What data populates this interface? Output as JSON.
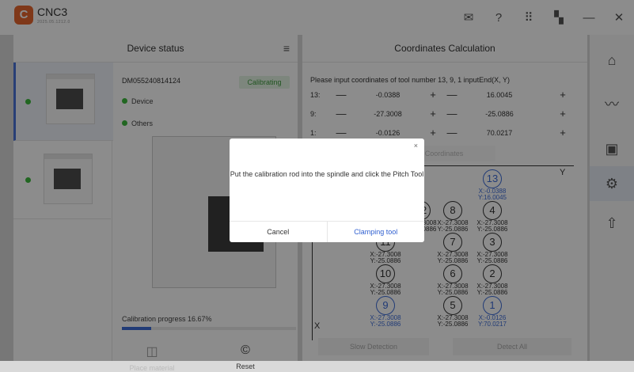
{
  "app": {
    "logo_glyph": "C",
    "title": "CNC3",
    "subtitle": "2025.05.1212.0"
  },
  "topbar_icons": [
    "mail-icon",
    "help-icon",
    "grid-icon",
    "device-icon",
    "minimize-icon",
    "close-icon"
  ],
  "topbar_glyphs": {
    "mail": "✉",
    "help": "?",
    "grid": "⠿",
    "device": "▚",
    "minimize": "—",
    "close": "✕"
  },
  "rail_glyphs": {
    "home": "⌂",
    "monitor": "〰",
    "screen": "▣",
    "settings": "⚙",
    "upload": "⇧"
  },
  "device_status": {
    "title": "Device status",
    "menu_glyph": "≡",
    "device_id": "DM055240814124",
    "badge": "Calibrating",
    "stat_device": "Device",
    "stat_others": "Others",
    "progress_label": "Calibration progress 16.67%",
    "progress_fraction": 0.1667,
    "place_material_icon": "◫",
    "place_material": "Place material",
    "reset_icon": "©",
    "reset": "Reset"
  },
  "coords": {
    "title": "Coordinates Calculation",
    "prompt": "Please input coordinates of tool number 13, 9, 1 inputEnd(X, Y)",
    "minus": "—",
    "plus": "+",
    "rows": [
      {
        "label": "13:",
        "x": "-0.0388",
        "y": "16.0045"
      },
      {
        "label": "9:",
        "x": "-27.3008",
        "y": "-25.0886"
      },
      {
        "label": "1:",
        "x": "-0.0126",
        "y": "70.0217"
      }
    ],
    "calc_button": "Calculate Coordinates",
    "axis_y": "Y",
    "axis_x": "X",
    "points": [
      {
        "n": "13",
        "x": "X:-0.0388",
        "y": "Y:16.0045",
        "blue": true
      },
      {
        "n": "12",
        "x": "X:-27.3008",
        "y": "Y:-25.0886",
        "blue": false
      },
      {
        "n": "8",
        "x": "X:-27.3008",
        "y": "Y:-25.0886",
        "blue": false
      },
      {
        "n": "4",
        "x": "X:-27.3008",
        "y": "Y:-25.0886",
        "blue": false
      },
      {
        "n": "11",
        "x": "X:-27.3008",
        "y": "Y:-25.0886",
        "blue": false
      },
      {
        "n": "7",
        "x": "X:-27.3008",
        "y": "Y:-25.0886",
        "blue": false
      },
      {
        "n": "3",
        "x": "X:-27.3008",
        "y": "Y:-25.0886",
        "blue": false
      },
      {
        "n": "10",
        "x": "X:-27.3008",
        "y": "Y:-25.0886",
        "blue": false
      },
      {
        "n": "6",
        "x": "X:-27.3008",
        "y": "Y:-25.0886",
        "blue": false
      },
      {
        "n": "2",
        "x": "X:-27.3008",
        "y": "Y:-25.0886",
        "blue": false
      },
      {
        "n": "9",
        "x": "X:-27.3008",
        "y": "Y:-25.0886",
        "blue": true
      },
      {
        "n": "5",
        "x": "X:-27.3008",
        "y": "Y:-25.0886",
        "blue": false
      },
      {
        "n": "1",
        "x": "X:-0.0126",
        "y": "Y:70.0217",
        "blue": true
      }
    ],
    "slow_detection": "Slow Detection",
    "detect_all": "Detect All"
  },
  "dialog": {
    "close": "×",
    "message": "Put the calibration rod into the spindle and click the Pitch Tool",
    "cancel": "Cancel",
    "confirm": "Clamping tool"
  },
  "colors": {
    "accent": "#3d6cd8",
    "status_green": "#3cba3c",
    "logo": "#e8672f"
  }
}
